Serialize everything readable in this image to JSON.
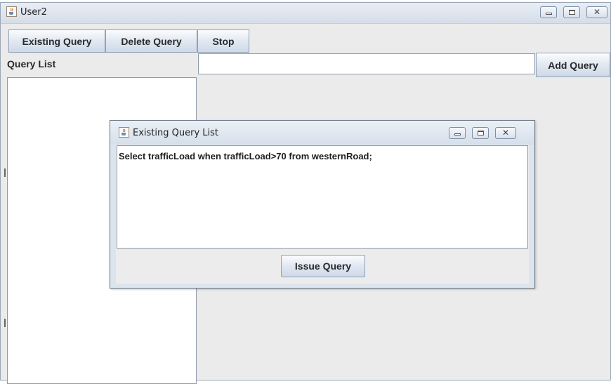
{
  "main_window": {
    "title": "User2",
    "toolbar": {
      "existing_query_label": "Existing Query",
      "delete_query_label": "Delete Query",
      "stop_label": "Stop"
    },
    "query_list_label": "Query List",
    "query_input": {
      "value": "",
      "placeholder": ""
    },
    "add_query_label": "Add Query",
    "controls": {
      "minimize": "minimize-icon",
      "maximize": "maximize-icon",
      "close": "close-icon"
    }
  },
  "dialog": {
    "title": "Existing Query List",
    "query_text": "Select trafficLoad when trafficLoad>70 from westernRoad;",
    "issue_query_label": "Issue Query"
  },
  "icons": {
    "app_icon": "java-cup-icon"
  },
  "colors": {
    "window_bg": "#ebebeb",
    "titlebar": "#d5dde8",
    "button_border": "#8fa1b8"
  }
}
